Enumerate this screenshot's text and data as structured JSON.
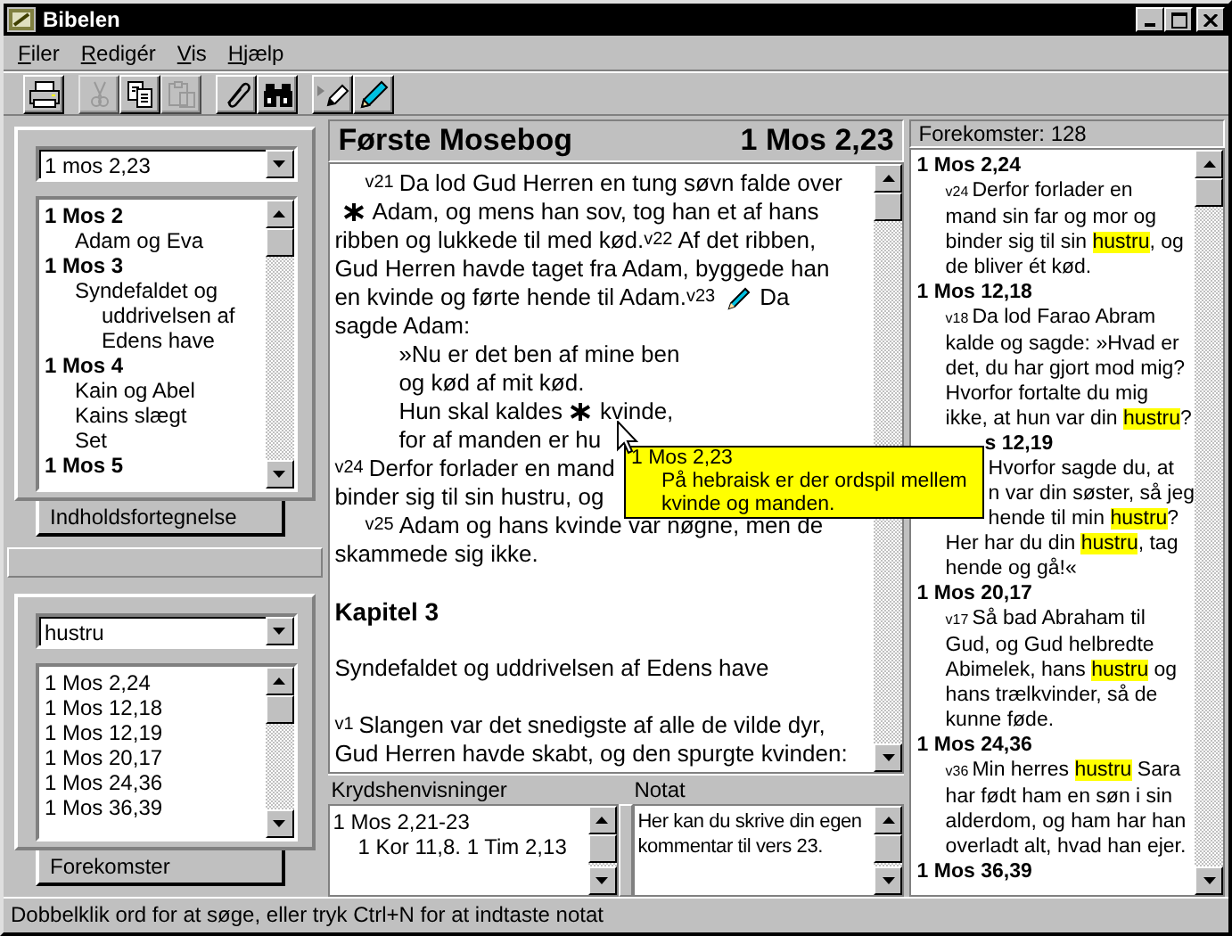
{
  "window": {
    "title": "Bibelen"
  },
  "menu": [
    "Filer",
    "Redigér",
    "Vis",
    "Hjælp"
  ],
  "toolbar": [
    [
      {
        "kind": "print",
        "disabled": false
      }
    ],
    [
      {
        "kind": "cut",
        "disabled": true
      },
      {
        "kind": "copy",
        "disabled": false
      },
      {
        "kind": "paste",
        "disabled": true
      }
    ],
    [
      {
        "kind": "clip",
        "disabled": false
      },
      {
        "kind": "binoculars",
        "disabled": false
      }
    ],
    [
      {
        "kind": "note-arrow",
        "disabled": false
      },
      {
        "kind": "pencil",
        "disabled": false
      }
    ]
  ],
  "contents_panel": {
    "reference": "1 mos 2,23",
    "tab": "Indholdsfortegnelse",
    "items": [
      {
        "label": "1 Mos 2",
        "children": [
          {
            "label": "Adam og Eva"
          }
        ]
      },
      {
        "label": "1 Mos 3",
        "children": [
          {
            "label": "Syndefaldet og uddrivelsen af Edens have"
          }
        ]
      },
      {
        "label": "1 Mos 4",
        "children": [
          {
            "label": "Kain og Abel"
          },
          {
            "label": "Kains slægt"
          },
          {
            "label": "Set"
          }
        ]
      },
      {
        "label": "1 Mos 5"
      }
    ]
  },
  "search_panel": {
    "query": "hustru",
    "tab": "Forekomster",
    "results": [
      "1 Mos 2,24",
      "1 Mos 12,18",
      "1 Mos 12,19",
      "1 Mos 20,17",
      "1 Mos 24,36",
      "1 Mos 36,39"
    ]
  },
  "reader": {
    "book": "Første Mosebog",
    "reference": "1 Mos 2,23",
    "lines": [
      {
        "kind": "indent",
        "segments": [
          {
            "kind": "verse",
            "text": "v21"
          },
          {
            "kind": "text",
            "text": "Da lod Gud Herren en tung søvn falde over"
          }
        ]
      },
      {
        "kind": "plain",
        "segments": [
          {
            "kind": "footnote"
          },
          {
            "kind": "text",
            "text": "Adam, og mens han sov, tog han et af hans"
          }
        ]
      },
      {
        "kind": "plain",
        "segments": [
          {
            "kind": "text",
            "text": "ribben og lukkede til med kød."
          },
          {
            "kind": "verse",
            "text": "v22"
          },
          {
            "kind": "text",
            "text": "Af det ribben,"
          }
        ]
      },
      {
        "kind": "plain",
        "segments": [
          {
            "kind": "text",
            "text": "Gud Herren havde taget fra Adam, byggede han"
          }
        ]
      },
      {
        "kind": "plain",
        "segments": [
          {
            "kind": "text",
            "text": "en kvinde og førte hende til Adam."
          },
          {
            "kind": "verse",
            "text": "v23"
          },
          {
            "kind": "note"
          },
          {
            "kind": "text",
            "text": "Da"
          }
        ]
      },
      {
        "kind": "plain",
        "segments": [
          {
            "kind": "text",
            "text": "sagde Adam:"
          }
        ]
      },
      {
        "kind": "poem",
        "segments": [
          {
            "kind": "text",
            "text": "»Nu er det ben af mine ben"
          }
        ]
      },
      {
        "kind": "poem",
        "segments": [
          {
            "kind": "text",
            "text": "og kød af mit kød."
          }
        ]
      },
      {
        "kind": "poem",
        "segments": [
          {
            "kind": "text",
            "text": "Hun skal kaldes"
          },
          {
            "kind": "footnote"
          },
          {
            "kind": "text",
            "text": "kvinde,"
          }
        ]
      },
      {
        "kind": "poem",
        "segments": [
          {
            "kind": "text",
            "text": "for af manden er hu"
          }
        ]
      },
      {
        "kind": "plain",
        "segments": [
          {
            "kind": "verse",
            "text": "v24"
          },
          {
            "kind": "text",
            "text": "Derfor forlader en mand"
          }
        ]
      },
      {
        "kind": "plain",
        "segments": [
          {
            "kind": "text",
            "text": "binder sig til sin hustru, og"
          }
        ]
      },
      {
        "kind": "indent",
        "segments": [
          {
            "kind": "verse",
            "text": "v25"
          },
          {
            "kind": "text",
            "text": "Adam og hans kvinde var nøgne, men de"
          }
        ]
      },
      {
        "kind": "plain",
        "segments": [
          {
            "kind": "text",
            "text": "skammede sig ikke."
          }
        ]
      },
      {
        "kind": "gap"
      },
      {
        "kind": "heading",
        "segments": [
          {
            "kind": "text",
            "text": "Kapitel 3"
          }
        ]
      },
      {
        "kind": "gap"
      },
      {
        "kind": "plain",
        "segments": [
          {
            "kind": "text",
            "text": "Syndefaldet og uddrivelsen af Edens have"
          }
        ]
      },
      {
        "kind": "gap"
      },
      {
        "kind": "plain",
        "segments": [
          {
            "kind": "verse",
            "text": "v1"
          },
          {
            "kind": "text",
            "text": "Slangen var det snedigste af alle de vilde dyr,"
          }
        ]
      },
      {
        "kind": "plain",
        "segments": [
          {
            "kind": "text",
            "text": "Gud Herren havde skabt, og den spurgte kvinden:"
          }
        ]
      }
    ]
  },
  "cross_references": {
    "title": "Krydshenvisninger",
    "items": [
      {
        "label": "1 Mos 2,21-23",
        "children": [
          {
            "label": "1 Kor 11,8. 1 Tim 2,13"
          }
        ]
      }
    ]
  },
  "note": {
    "title": "Notat",
    "value": "Her kan du skrive din egen kommentar til vers 23."
  },
  "occurrences": {
    "title": "Forekomster: 128",
    "entries": [
      {
        "reference": "1 Mos 2,24",
        "covered": false,
        "lines": [
          {
            "covered": false,
            "segments": [
              {
                "kind": "verse",
                "text": "v24"
              },
              {
                "kind": "text",
                "text": "Derfor forlader en"
              }
            ]
          },
          {
            "covered": false,
            "segments": [
              {
                "kind": "text",
                "text": "mand sin far og mor og"
              }
            ]
          },
          {
            "covered": false,
            "segments": [
              {
                "kind": "text",
                "text": "binder sig til sin "
              },
              {
                "kind": "hit",
                "text": "hustru"
              },
              {
                "kind": "text",
                "text": ", og"
              }
            ]
          },
          {
            "covered": false,
            "segments": [
              {
                "kind": "text",
                "text": "de bliver ét kød."
              }
            ]
          }
        ]
      },
      {
        "reference": "1 Mos 12,18",
        "covered": false,
        "lines": [
          {
            "covered": false,
            "segments": [
              {
                "kind": "verse",
                "text": "v18"
              },
              {
                "kind": "text",
                "text": "Da lod Farao Abram"
              }
            ]
          },
          {
            "covered": false,
            "segments": [
              {
                "kind": "text",
                "text": "kalde og sagde: »Hvad er"
              }
            ]
          },
          {
            "covered": false,
            "segments": [
              {
                "kind": "text",
                "text": "det, du har gjort mod mig?"
              }
            ]
          },
          {
            "covered": false,
            "segments": [
              {
                "kind": "text",
                "text": "Hvorfor fortalte du mig"
              }
            ]
          },
          {
            "covered": false,
            "segments": [
              {
                "kind": "text",
                "text": "ikke, at hun var din "
              },
              {
                "kind": "hit",
                "text": "hustru"
              },
              {
                "kind": "text",
                "text": "?"
              }
            ]
          }
        ]
      },
      {
        "reference": "s 12,19",
        "covered": true,
        "lines": [
          {
            "covered": true,
            "segments": [
              {
                "kind": "text",
                "text": "Hvorfor sagde du, at"
              }
            ]
          },
          {
            "covered": true,
            "segments": [
              {
                "kind": "text",
                "text": "n var din søster, så jeg"
              }
            ]
          },
          {
            "covered": true,
            "segments": [
              {
                "kind": "text",
                "text": "hende til min "
              },
              {
                "kind": "hit",
                "text": "hustru"
              },
              {
                "kind": "text",
                "text": "?"
              }
            ]
          },
          {
            "covered": false,
            "segments": [
              {
                "kind": "text",
                "text": "Her har du din "
              },
              {
                "kind": "hit",
                "text": "hustru"
              },
              {
                "kind": "text",
                "text": ", tag"
              }
            ]
          },
          {
            "covered": false,
            "segments": [
              {
                "kind": "text",
                "text": "hende og gå!«"
              }
            ]
          }
        ]
      },
      {
        "reference": "1 Mos 20,17",
        "covered": false,
        "lines": [
          {
            "covered": false,
            "segments": [
              {
                "kind": "verse",
                "text": "v17"
              },
              {
                "kind": "text",
                "text": "Så bad Abraham til"
              }
            ]
          },
          {
            "covered": false,
            "segments": [
              {
                "kind": "text",
                "text": "Gud, og Gud helbredte"
              }
            ]
          },
          {
            "covered": false,
            "segments": [
              {
                "kind": "text",
                "text": "Abimelek, hans "
              },
              {
                "kind": "hit",
                "text": "hustru"
              },
              {
                "kind": "text",
                "text": " og"
              }
            ]
          },
          {
            "covered": false,
            "segments": [
              {
                "kind": "text",
                "text": "hans trælkvinder, så de"
              }
            ]
          },
          {
            "covered": false,
            "segments": [
              {
                "kind": "text",
                "text": "kunne føde."
              }
            ]
          }
        ]
      },
      {
        "reference": "1 Mos 24,36",
        "covered": false,
        "lines": [
          {
            "covered": false,
            "segments": [
              {
                "kind": "verse",
                "text": "v36"
              },
              {
                "kind": "text",
                "text": "Min herres "
              },
              {
                "kind": "hit",
                "text": "hustru"
              },
              {
                "kind": "text",
                "text": " Sara"
              }
            ]
          },
          {
            "covered": false,
            "segments": [
              {
                "kind": "text",
                "text": "har født ham en søn i sin"
              }
            ]
          },
          {
            "covered": false,
            "segments": [
              {
                "kind": "text",
                "text": "alderdom, og ham har han"
              }
            ]
          },
          {
            "covered": false,
            "segments": [
              {
                "kind": "text",
                "text": "overladt alt, hvad han ejer."
              }
            ]
          }
        ]
      },
      {
        "reference": "1 Mos 36,39",
        "covered": false
      }
    ]
  },
  "tooltip": {
    "reference": "1 Mos 2,23",
    "text": "På hebraisk er der ordspil mellem kvinde og manden."
  },
  "status_bar": "Dobbelklik ord for at søge, eller tryk Ctrl+N for at indtaste notat"
}
